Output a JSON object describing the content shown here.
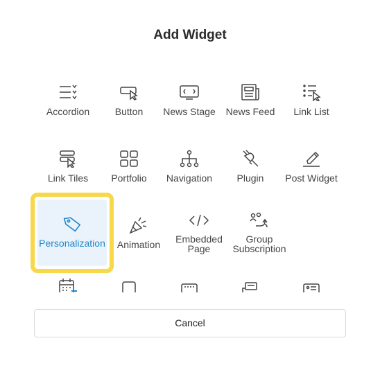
{
  "dialog": {
    "title": "Add Widget",
    "cancel_label": "Cancel"
  },
  "widgets": [
    {
      "label": "Accordion",
      "icon": "accordion-icon"
    },
    {
      "label": "Button",
      "icon": "button-icon"
    },
    {
      "label": "News Stage",
      "icon": "news-stage-icon"
    },
    {
      "label": "News Feed",
      "icon": "news-feed-icon"
    },
    {
      "label": "Link List",
      "icon": "link-list-icon"
    },
    {
      "label": "Link Tiles",
      "icon": "link-tiles-icon"
    },
    {
      "label": "Portfolio",
      "icon": "portfolio-icon"
    },
    {
      "label": "Navigation",
      "icon": "navigation-icon"
    },
    {
      "label": "Plugin",
      "icon": "plugin-icon"
    },
    {
      "label": "Post Widget",
      "icon": "post-widget-icon"
    },
    {
      "label": "Personalization",
      "icon": "tag-icon",
      "selected": true
    },
    {
      "label": "Animation",
      "icon": "party-popper-icon"
    },
    {
      "label": "Embedded Page",
      "icon": "code-icon"
    },
    {
      "label": "Group Subscription",
      "icon": "group-subscription-icon"
    }
  ],
  "colors": {
    "accent": "#1e88c9",
    "highlight": "#f6d84a",
    "selected_bg": "#eaf3fb"
  }
}
